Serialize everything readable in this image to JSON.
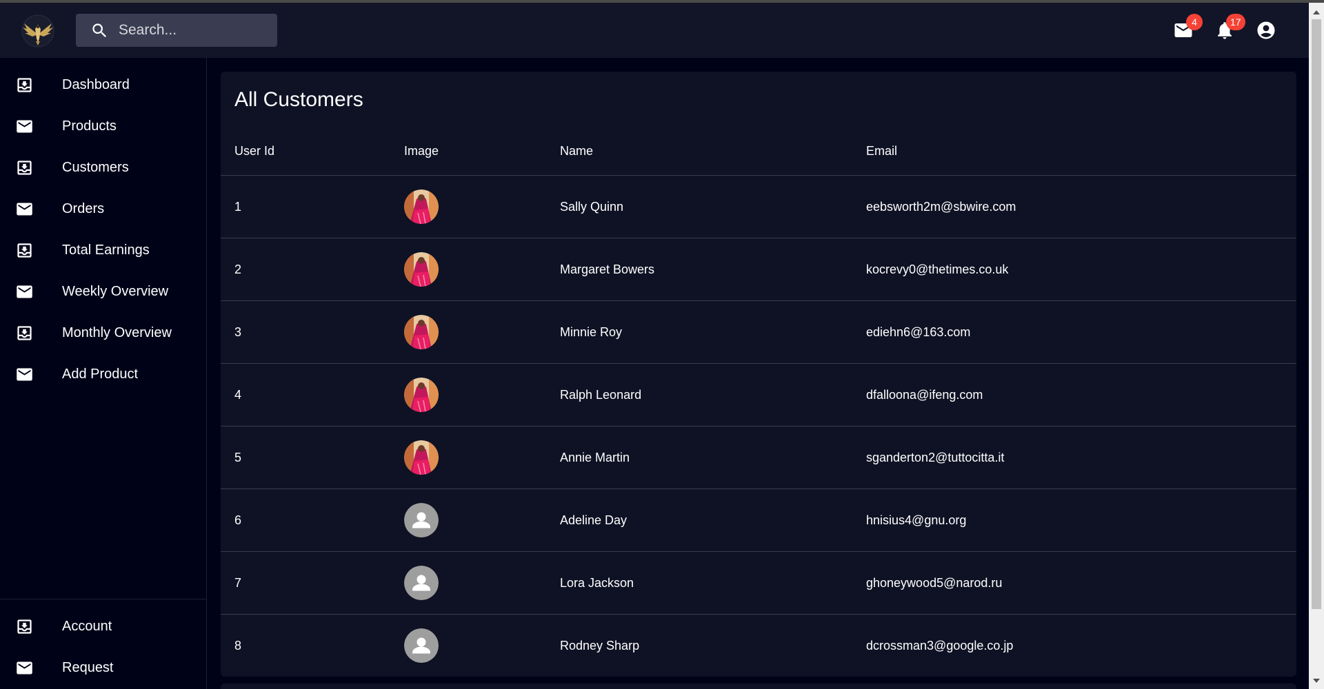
{
  "app": {
    "logo": "eagle-logo",
    "search": {
      "placeholder": "Search..."
    },
    "mail_badge": "4",
    "notifications_badge": "17"
  },
  "sidebar": {
    "items": [
      {
        "label": "Dashboard",
        "icon": "download-box-icon"
      },
      {
        "label": "Products",
        "icon": "mail-icon"
      },
      {
        "label": "Customers",
        "icon": "download-box-icon"
      },
      {
        "label": "Orders",
        "icon": "mail-icon"
      },
      {
        "label": "Total Earnings",
        "icon": "download-box-icon"
      },
      {
        "label": "Weekly Overview",
        "icon": "mail-icon"
      },
      {
        "label": "Monthly Overview",
        "icon": "download-box-icon"
      },
      {
        "label": "Add Product",
        "icon": "mail-icon"
      }
    ],
    "bottom_items": [
      {
        "label": "Account",
        "icon": "download-box-icon"
      },
      {
        "label": "Request",
        "icon": "mail-icon"
      }
    ]
  },
  "main": {
    "title": "All Customers",
    "columns": [
      "User Id",
      "Image",
      "Name",
      "Email"
    ],
    "rows": [
      {
        "id": "1",
        "image": "photo-avatar",
        "name": "Sally Quinn",
        "email": "eebsworth2m@sbwire.com"
      },
      {
        "id": "2",
        "image": "photo-avatar",
        "name": "Margaret Bowers",
        "email": "kocrevy0@thetimes.co.uk"
      },
      {
        "id": "3",
        "image": "photo-avatar",
        "name": "Minnie Roy",
        "email": "ediehn6@163.com"
      },
      {
        "id": "4",
        "image": "photo-avatar",
        "name": "Ralph Leonard",
        "email": "dfalloona@ifeng.com"
      },
      {
        "id": "5",
        "image": "photo-avatar",
        "name": "Annie Martin",
        "email": "sganderton2@tuttocitta.it"
      },
      {
        "id": "6",
        "image": "default-person-avatar",
        "name": "Adeline Day",
        "email": "hnisius4@gnu.org"
      },
      {
        "id": "7",
        "image": "default-person-avatar",
        "name": "Lora Jackson",
        "email": "ghoneywood5@narod.ru"
      },
      {
        "id": "8",
        "image": "default-person-avatar",
        "name": "Rodney Sharp",
        "email": "dcrossman3@google.co.jp"
      }
    ]
  },
  "colors": {
    "background": "#000318",
    "appbar": "#121527",
    "card": "#0f1224",
    "badge": "#f44336"
  }
}
